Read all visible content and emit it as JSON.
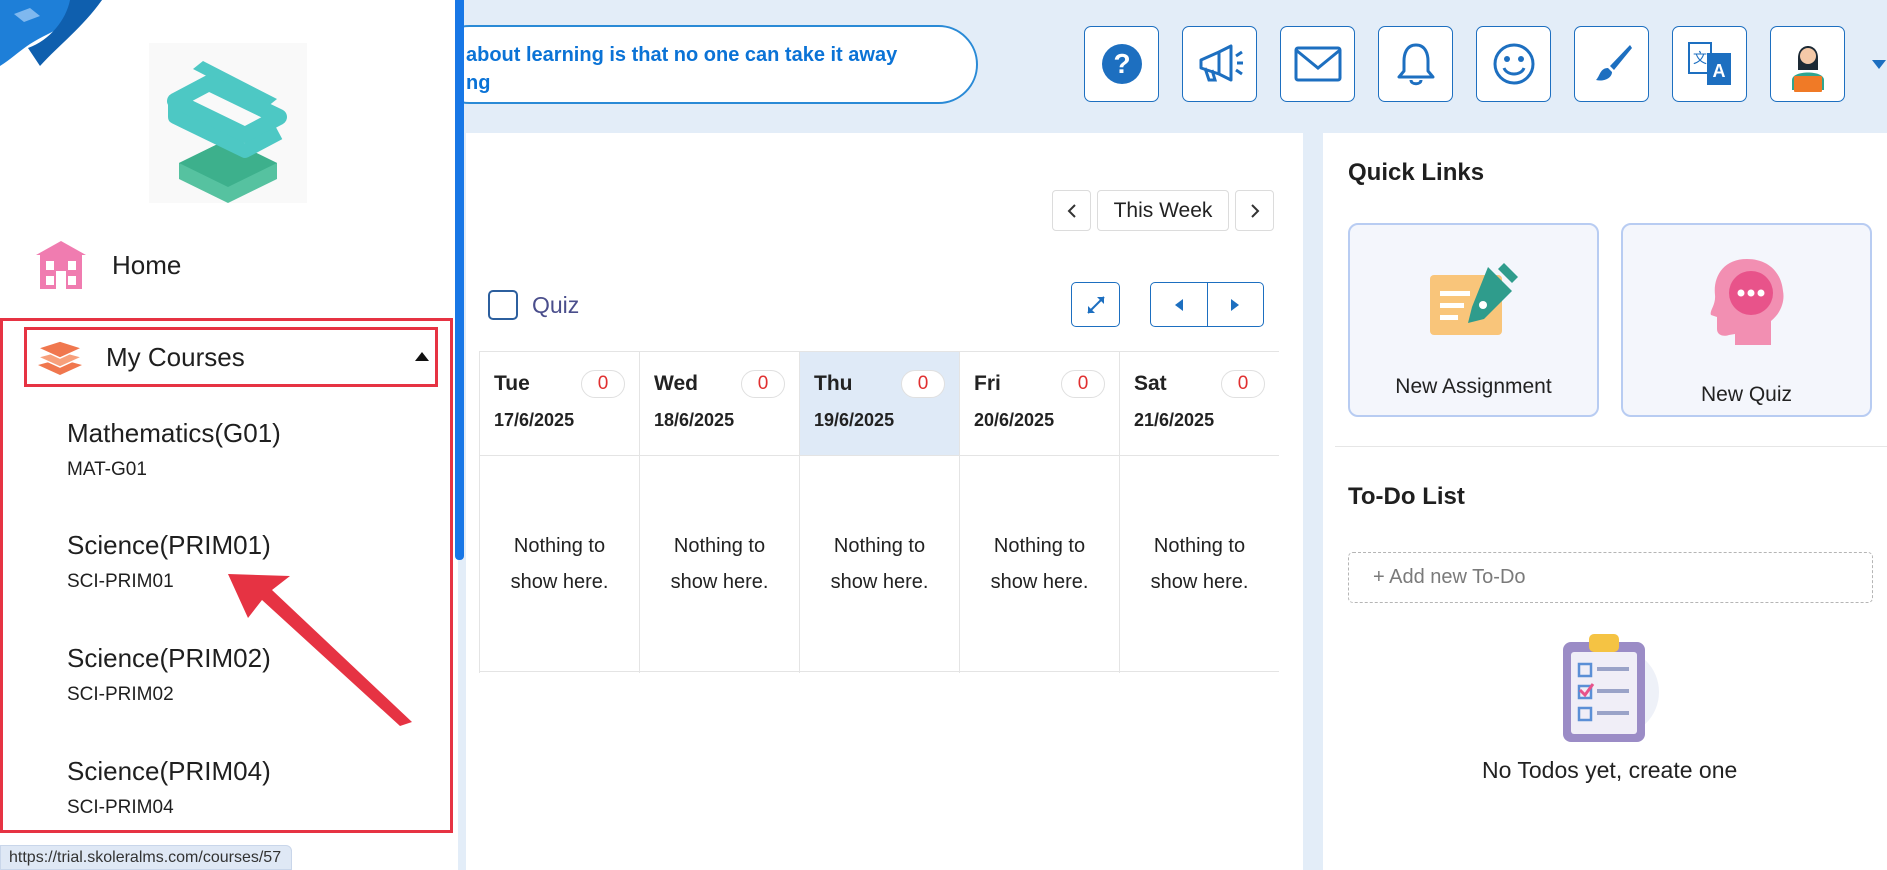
{
  "header": {
    "quote_line1": "about learning is that no one can take it away",
    "quote_line2": "ng",
    "icons": [
      "help-icon",
      "megaphone-icon",
      "mail-icon",
      "bell-icon",
      "smiley-icon",
      "brush-icon",
      "translate-icon",
      "avatar-icon"
    ]
  },
  "sidebar": {
    "home_label": "Home",
    "my_courses_label": "My Courses",
    "courses": [
      {
        "name": "Mathematics(G01)",
        "code": "MAT-G01"
      },
      {
        "name": "Science(PRIM01)",
        "code": "SCI-PRIM01"
      },
      {
        "name": "Science(PRIM02)",
        "code": "SCI-PRIM02"
      },
      {
        "name": "Science(PRIM04)",
        "code": "SCI-PRIM04"
      }
    ]
  },
  "calendar": {
    "week_label": "This Week",
    "filter_label": "Quiz",
    "days": [
      {
        "name": "Tue",
        "date": "17/6/2025",
        "count": "0",
        "empty": "Nothing to show here."
      },
      {
        "name": "Wed",
        "date": "18/6/2025",
        "count": "0",
        "empty": "Nothing to show here."
      },
      {
        "name": "Thu",
        "date": "19/6/2025",
        "count": "0",
        "empty": "Nothing to show here."
      },
      {
        "name": "Fri",
        "date": "20/6/2025",
        "count": "0",
        "empty": "Nothing to show here."
      },
      {
        "name": "Sat",
        "date": "21/6/2025",
        "count": "0",
        "empty": "Nothing to show here."
      }
    ]
  },
  "quick_links": {
    "title": "Quick Links",
    "new_assignment": "New Assignment",
    "new_quiz": "New Quiz"
  },
  "todo": {
    "title": "To-Do List",
    "placeholder": "+ Add new To-Do",
    "empty": "No Todos yet, create one"
  },
  "status_bar": {
    "url": "https://trial.skoleralms.com/courses/57"
  },
  "colors": {
    "accent": "#1d6fc0",
    "highlight_red": "#e63343",
    "today_bg": "#dfeaf7",
    "count_red": "#e03030"
  }
}
